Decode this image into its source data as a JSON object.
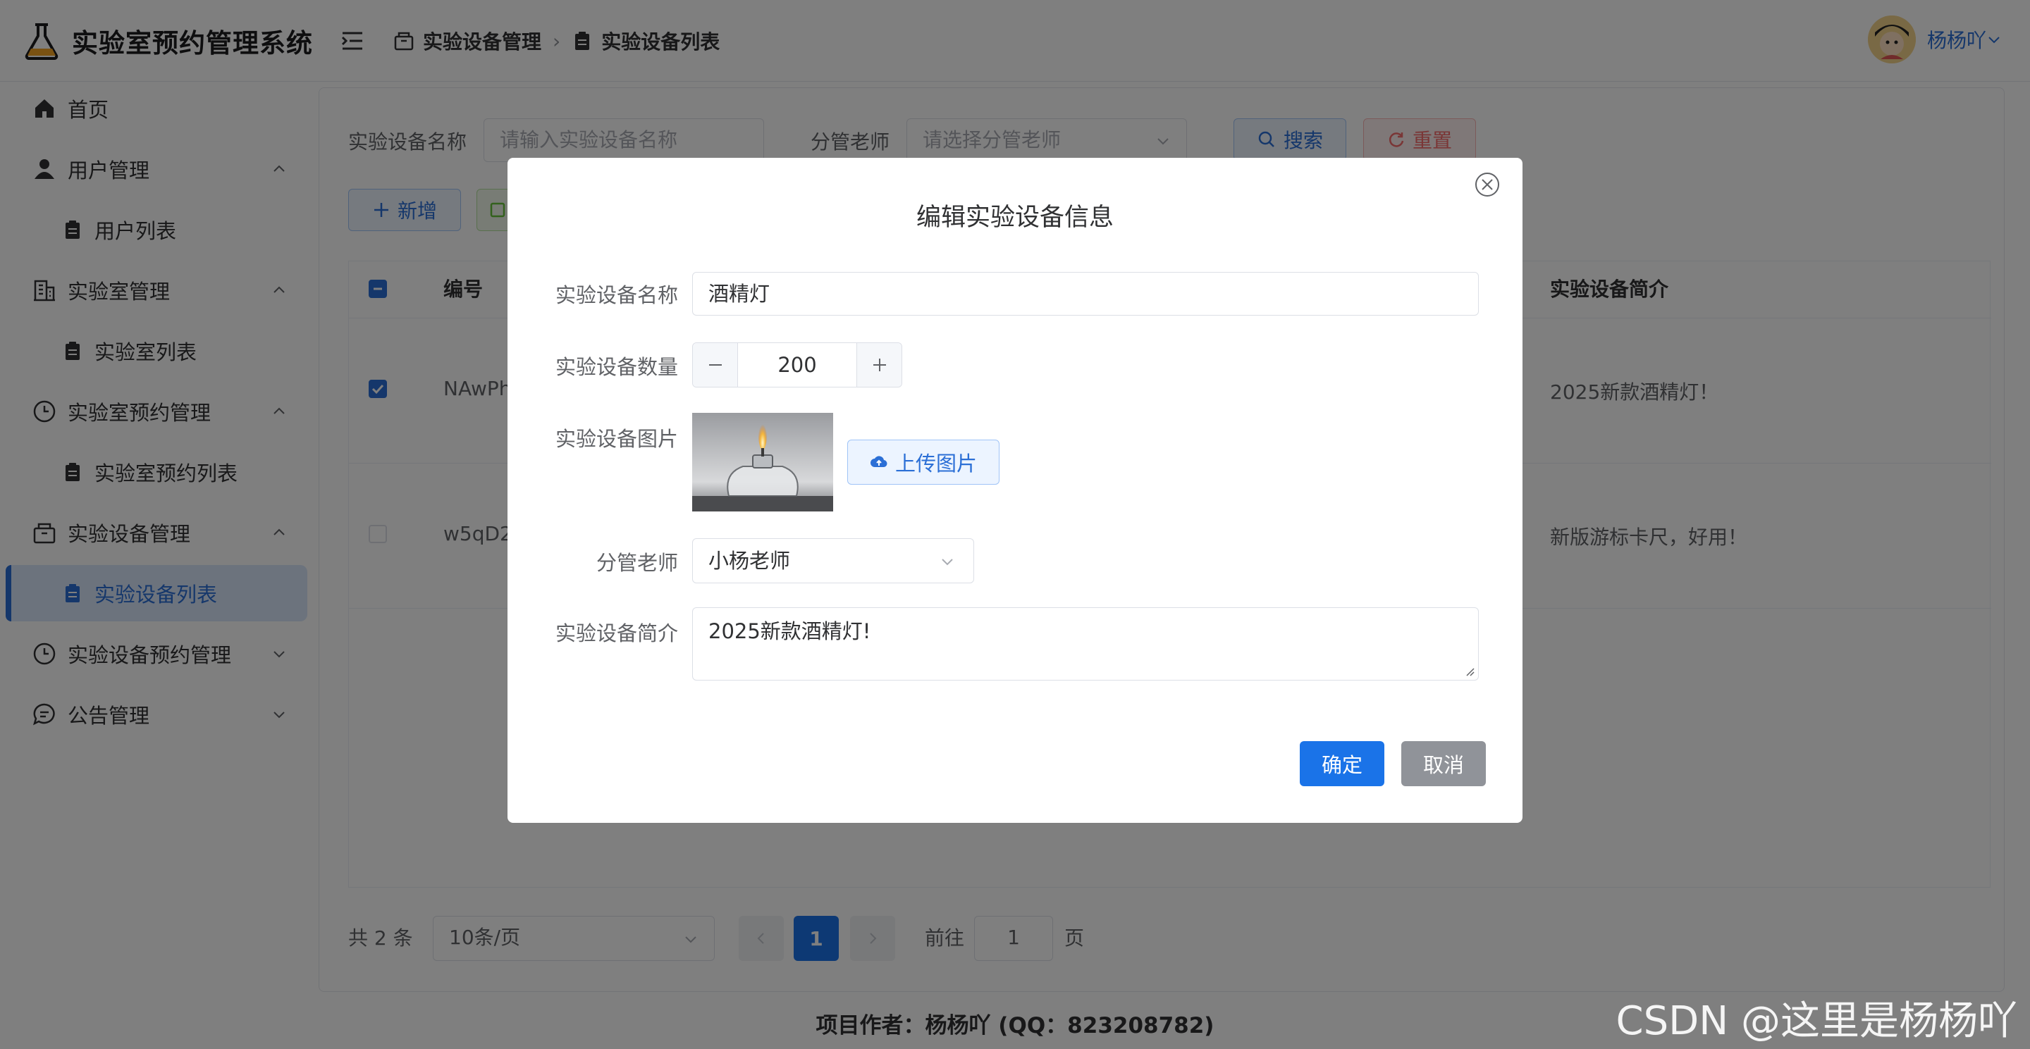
{
  "app": {
    "title": "实验室预约管理系统"
  },
  "breadcrumb": {
    "section": "实验设备管理",
    "page": "实验设备列表"
  },
  "user": {
    "name": "杨杨吖"
  },
  "sidebar": {
    "items": [
      {
        "label": "首页"
      },
      {
        "label": "用户管理"
      },
      {
        "label": "用户列表"
      },
      {
        "label": "实验室管理"
      },
      {
        "label": "实验室列表"
      },
      {
        "label": "实验室预约管理"
      },
      {
        "label": "实验室预约列表"
      },
      {
        "label": "实验设备管理"
      },
      {
        "label": "实验设备列表"
      },
      {
        "label": "实验设备预约管理"
      },
      {
        "label": "公告管理"
      }
    ]
  },
  "search": {
    "name_label": "实验设备名称",
    "name_placeholder": "请输入实验设备名称",
    "teacher_label": "分管老师",
    "teacher_placeholder": "请选择分管老师",
    "search_button": "搜索",
    "reset_button": "重置"
  },
  "toolbar": {
    "add_button": "新增"
  },
  "table": {
    "headers": {
      "id": "编号",
      "intro": "实验设备简介"
    },
    "rows": [
      {
        "id": "NAwPh",
        "intro": "2025新款酒精灯！",
        "checked": true
      },
      {
        "id": "w5qD2",
        "intro": "新版游标卡尺，好用！",
        "checked": false
      }
    ]
  },
  "pagination": {
    "total": "共 2 条",
    "page_size": "10条/页",
    "current_page": "1",
    "goto_label": "前往",
    "goto_value": "1",
    "page_unit": "页"
  },
  "footer": {
    "text": "项目作者：杨杨吖 (QQ：823208782)"
  },
  "dialog": {
    "title": "编辑实验设备信息",
    "fields": {
      "name_label": "实验设备名称",
      "name_value": "酒精灯",
      "quantity_label": "实验设备数量",
      "quantity_value": "200",
      "image_label": "实验设备图片",
      "upload_button": "上传图片",
      "teacher_label": "分管老师",
      "teacher_value": "小杨老师",
      "intro_label": "实验设备简介",
      "intro_value": "2025新款酒精灯!"
    },
    "confirm_button": "确定",
    "cancel_button": "取消"
  },
  "watermark": "CSDN @这里是杨杨吖",
  "colors": {
    "primary": "#1a73e8",
    "active_menu_bg": "#d9e6fb",
    "danger": "#f56c6c",
    "overlay": "rgba(0,0,0,0.5)"
  },
  "icons": [
    "flask-logo-icon",
    "menu-fold-icon",
    "box-icon",
    "clipboard-icon",
    "home-icon",
    "user-icon",
    "building-icon",
    "clock-icon",
    "chat-icon",
    "chevron-up-icon",
    "chevron-down-icon",
    "search-icon",
    "refresh-icon",
    "plus-icon",
    "close-circle-icon",
    "cloud-upload-icon"
  ]
}
